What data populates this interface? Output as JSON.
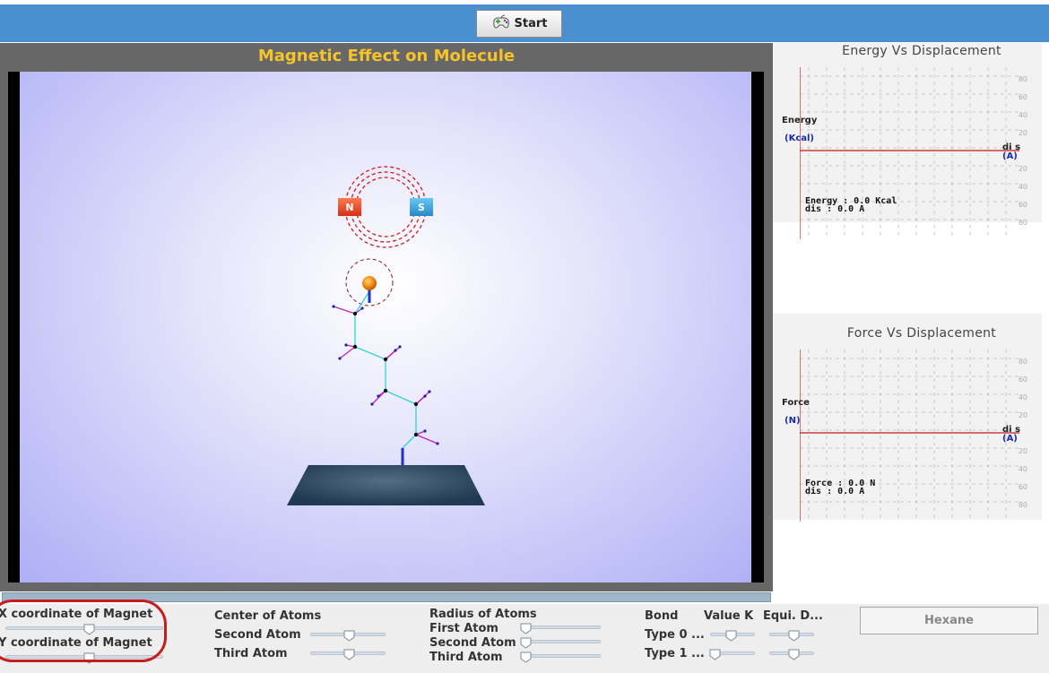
{
  "toolbar": {
    "start_label": "Start"
  },
  "stage": {
    "title": "Magnetic Effect on Molecule",
    "magnet_north": "N",
    "magnet_south": "S"
  },
  "energy_graph": {
    "title": "Energy Vs Displacement",
    "ylabel": "Energy",
    "yunit": "(Kcal)",
    "xlabel": "di s",
    "xunit": "(A)",
    "ticks": [
      "80",
      "60",
      "40",
      "20",
      "20",
      "40",
      "60",
      "80"
    ],
    "readout_value": "Energy : 0.0 Kcal",
    "readout_dis": "dis : 0.0 A"
  },
  "force_graph": {
    "title": "Force Vs Displacement",
    "ylabel": "Force",
    "yunit": "(N)",
    "xlabel": "di s",
    "xunit": "(A)",
    "ticks": [
      "80",
      "60",
      "40",
      "20",
      "20",
      "40",
      "60",
      "80"
    ],
    "readout_value": "Force : 0.0 N",
    "readout_dis": "dis : 0.0 A"
  },
  "controls": {
    "x_magnet": "X coordinate of Magnet",
    "y_magnet": "Y coordinate of Magnet",
    "center_atoms": "Center of Atoms",
    "second_atom": "Second Atom",
    "third_atom": "Third Atom",
    "radius_atoms": "Radius of Atoms",
    "first_atom": "First Atom",
    "radius_second_atom": "Second Atom",
    "radius_third_atom": "Third Atom",
    "bond": "Bond",
    "value_k": "Value K",
    "equi_d": "Equi. D...",
    "type0": "Type 0 ...",
    "type1": "Type 1 ...",
    "hexane": "Hexane"
  },
  "colors": {
    "topbar": "#4a8fd0",
    "title": "#f7c32a",
    "highlight": "#c81b1b",
    "axis": "#cc1a1a"
  }
}
